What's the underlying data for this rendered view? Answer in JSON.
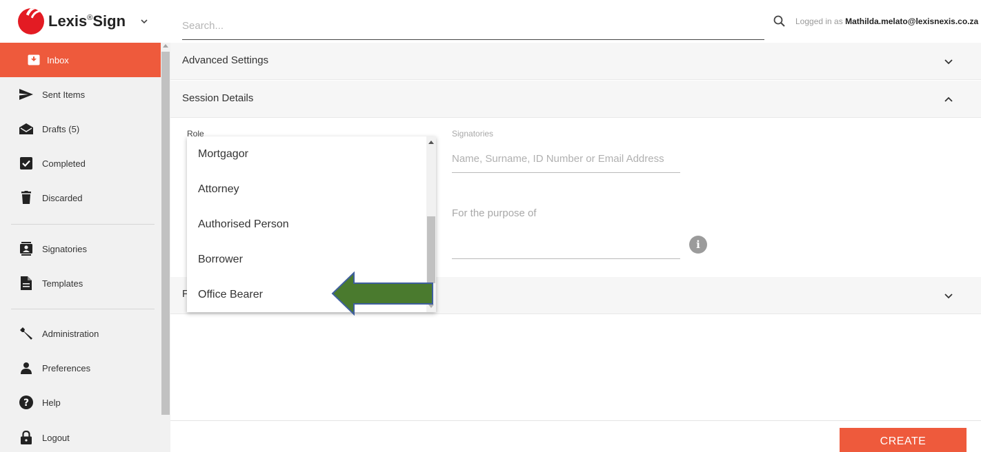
{
  "header": {
    "logo_text": "Lexis",
    "logo_reg": "®",
    "logo_suffix": "Sign",
    "search_placeholder": "Search...",
    "logged_in_prefix": "Logged in as",
    "logged_in_user": "Mathilda.melato@lexisnexis.co.za"
  },
  "sidebar": {
    "items": [
      {
        "label": "Inbox",
        "icon": "inbox-icon",
        "active": true
      },
      {
        "label": "Sent Items",
        "icon": "send-icon"
      },
      {
        "label": "Drafts (5)",
        "icon": "envelope-open-icon"
      },
      {
        "label": "Completed",
        "icon": "checkbox-icon"
      },
      {
        "label": "Discarded",
        "icon": "trash-icon"
      },
      {
        "label": "Signatories",
        "icon": "contact-icon"
      },
      {
        "label": "Templates",
        "icon": "document-icon"
      },
      {
        "label": "Administration",
        "icon": "wrench-icon"
      },
      {
        "label": "Preferences",
        "icon": "person-icon"
      },
      {
        "label": "Help",
        "icon": "help-icon"
      },
      {
        "label": "Logout",
        "icon": "lock-icon"
      }
    ]
  },
  "main": {
    "advanced_settings": "Advanced Settings",
    "session_details": "Session Details",
    "role_label": "Role",
    "signatories_label": "Signatories",
    "signatories_placeholder": "Name, Surname, ID Number or Email Address",
    "purpose_label": "For the purpose of",
    "info_glyph": "i",
    "collapsed_panel_initial": "F",
    "role_options": [
      "Mortgagor",
      "Attorney",
      "Authorised Person",
      "Borrower",
      "Office Bearer"
    ],
    "create_label": "CREATE"
  },
  "colors": {
    "accent": "#ee5a3c",
    "sidebar_bg": "#f1f1f1",
    "arrow_fill": "#4a7a2e",
    "arrow_stroke": "#3f5f9e"
  }
}
